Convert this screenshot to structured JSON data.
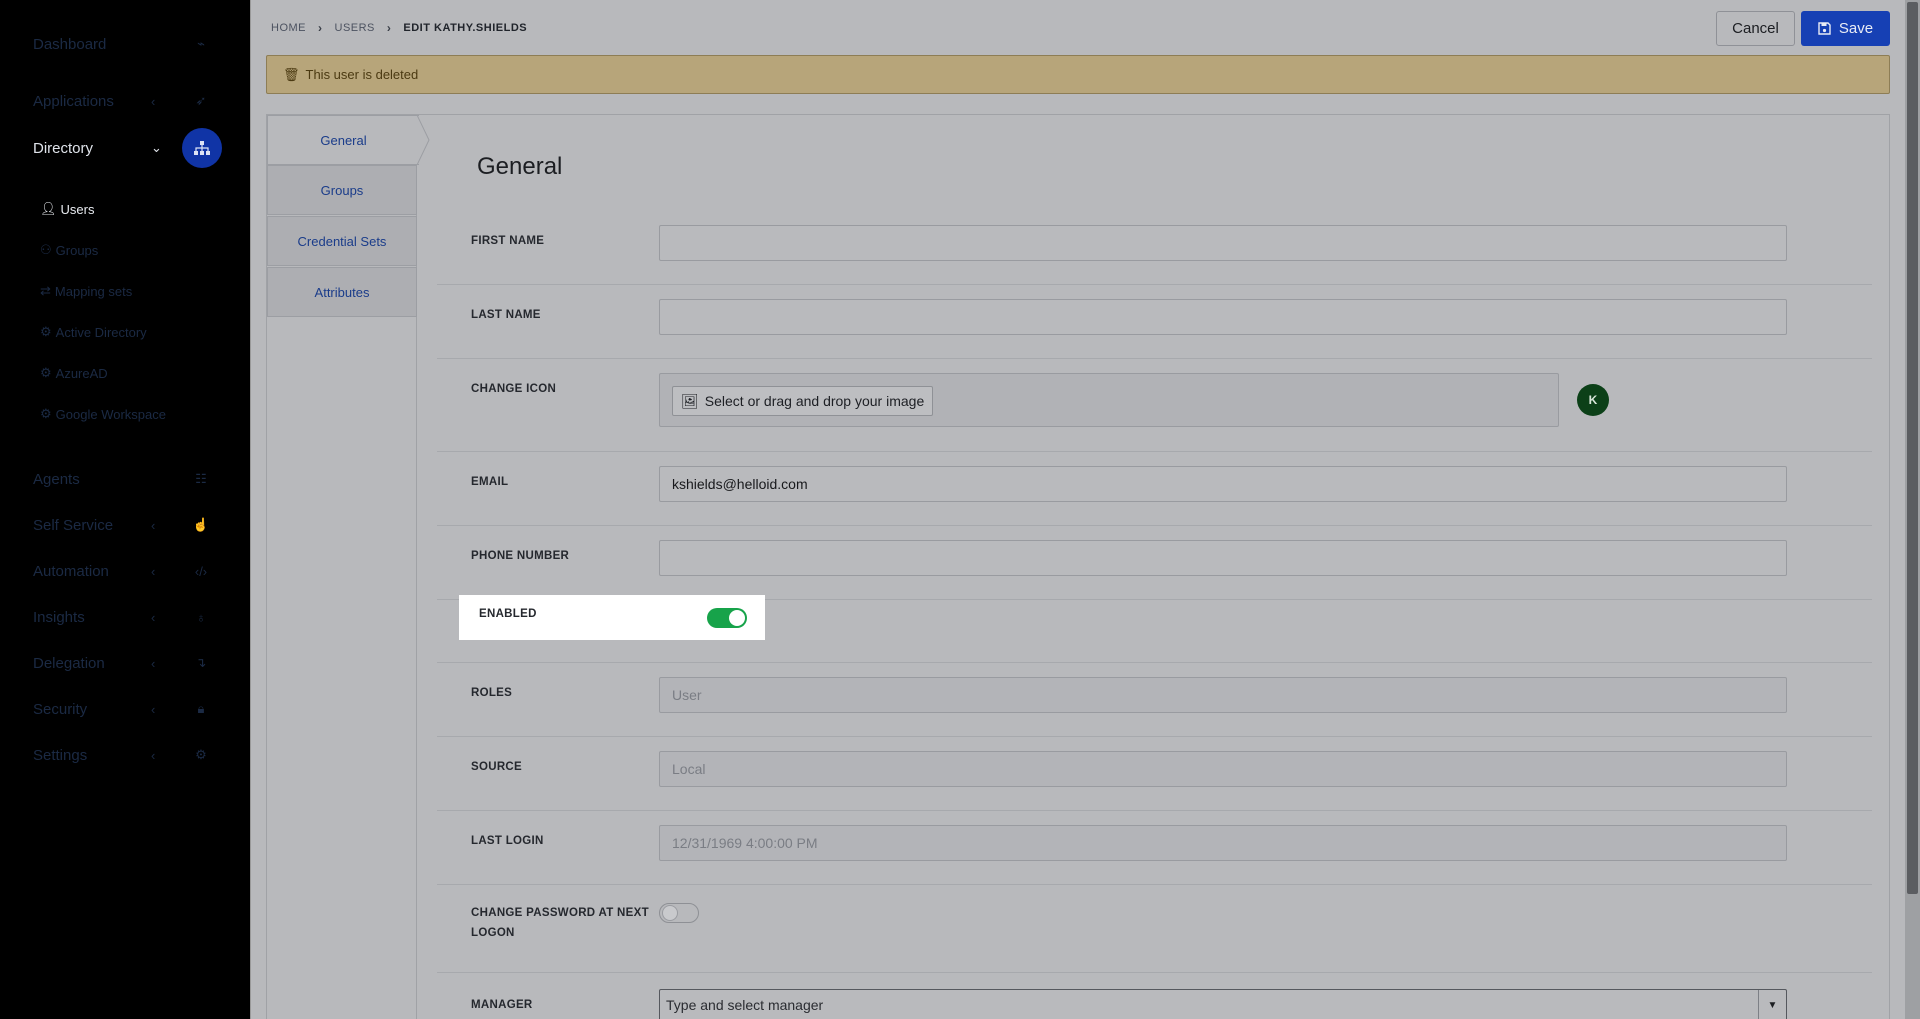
{
  "sidebar": {
    "items": [
      {
        "label": "Dashboard",
        "icon": "speedometer-icon"
      },
      {
        "label": "Applications",
        "icon": "rocket-icon"
      },
      {
        "label": "Directory",
        "icon": "sitemap-icon"
      },
      {
        "label": "Agents",
        "icon": "servers-icon"
      },
      {
        "label": "Self Service",
        "icon": "hand-icon"
      },
      {
        "label": "Automation",
        "icon": "code-icon"
      },
      {
        "label": "Insights",
        "icon": "lightbulb-icon"
      },
      {
        "label": "Delegation",
        "icon": "arrow-turn-icon"
      },
      {
        "label": "Security",
        "icon": "lock-icon"
      },
      {
        "label": "Settings",
        "icon": "gear-icon"
      }
    ],
    "subitems": [
      {
        "label": "Users",
        "icon": "user-icon"
      },
      {
        "label": "Groups",
        "icon": "users-icon"
      },
      {
        "label": "Mapping sets",
        "icon": "exchange-icon"
      },
      {
        "label": "Active Directory",
        "icon": "gear-icon"
      },
      {
        "label": "AzureAD",
        "icon": "gear-icon"
      },
      {
        "label": "Google Workspace",
        "icon": "gear-icon"
      }
    ]
  },
  "header": {
    "breadcrumb": [
      "HOME",
      "USERS",
      "EDIT KATHY.SHIELDS"
    ],
    "cancel_label": "Cancel",
    "save_label": "Save"
  },
  "alert": {
    "text": "This user is deleted",
    "icon": "trash-icon"
  },
  "tabs": [
    "General",
    "Groups",
    "Credential Sets",
    "Attributes"
  ],
  "form": {
    "title": "General",
    "first_name": {
      "label": "FIRST NAME",
      "value": ""
    },
    "last_name": {
      "label": "LAST NAME",
      "value": ""
    },
    "change_icon": {
      "label": "CHANGE ICON",
      "button": "Select or drag and drop your image",
      "avatar_letter": "K",
      "avatar_color": "#0c4018"
    },
    "email": {
      "label": "EMAIL",
      "value": "kshields@helloid.com"
    },
    "phone": {
      "label": "PHONE NUMBER",
      "value": ""
    },
    "enabled": {
      "label": "ENABLED",
      "on": true,
      "color": "#17a34a"
    },
    "roles": {
      "label": "ROLES",
      "value": "User"
    },
    "source": {
      "label": "SOURCE",
      "value": "Local"
    },
    "last_login": {
      "label": "LAST LOGIN",
      "value": "12/31/1969 4:00:00 PM"
    },
    "change_password": {
      "label_line1": "CHANGE PASSWORD AT NEXT",
      "label_line2": "LOGON",
      "on": false
    },
    "manager": {
      "label": "MANAGER",
      "placeholder": "Type and select manager"
    }
  },
  "colors": {
    "accent": "#1640b4",
    "alert_bg": "#b7a57a"
  }
}
